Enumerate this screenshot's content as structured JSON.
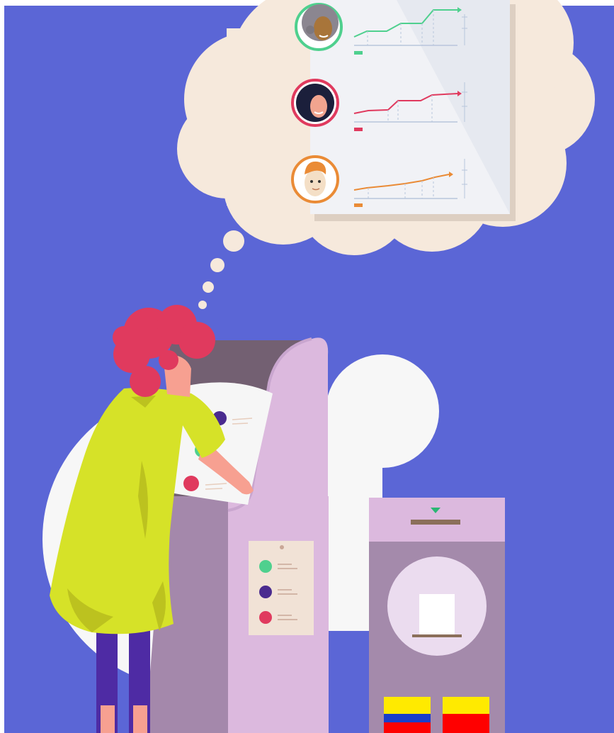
{
  "illustration": {
    "theme": "voting-booth-thought-bubble",
    "colors": {
      "background": "#5b66d6",
      "bubble": "#f6e9dc",
      "backdrop_circle": "#f7f7f7",
      "booth_front": "#dcb9de",
      "booth_side": "#a488ab",
      "booth_top": "#736072",
      "ballot_box": "#dcb9de",
      "ballot_box_body": "#a48aab",
      "dress": "#d6e228",
      "dress_shadow": "#bcc21f",
      "hair": "#e03a5e",
      "skin": "#f7a091",
      "leggings": "#4e2ba4",
      "candidate_green": "#4fd08e",
      "candidate_red": "#e03a5e",
      "candidate_orange": "#ea8b36",
      "candidate_purple": "#4a2b8f"
    },
    "candidates": [
      {
        "icon": "woman-gray-hair-avatar-icon",
        "ring_color": "#4fd08e",
        "trend": [
          52,
          52,
          44,
          44,
          33,
          33,
          14
        ]
      },
      {
        "icon": "woman-dark-hair-avatar-icon",
        "ring_color": "#e03a5e",
        "trend": [
          160,
          156,
          155,
          142,
          142,
          134,
          132
        ]
      },
      {
        "icon": "man-orange-hair-avatar-icon",
        "ring_color": "#ea8b36",
        "trend": [
          268,
          265,
          262,
          259,
          255,
          250,
          246
        ]
      }
    ],
    "ballot_options": [
      "#4a2b8f",
      "#4fd08e",
      "#e03a5e"
    ],
    "flags": [
      {
        "icon": "colombia-flag-icon",
        "stripes": [
          "#ffea00",
          "#1a3ec9",
          "#ff0000"
        ]
      },
      {
        "icon": "yellow-red-flag-icon",
        "stripes": [
          "#ffea00",
          "#ff0000"
        ]
      }
    ]
  }
}
